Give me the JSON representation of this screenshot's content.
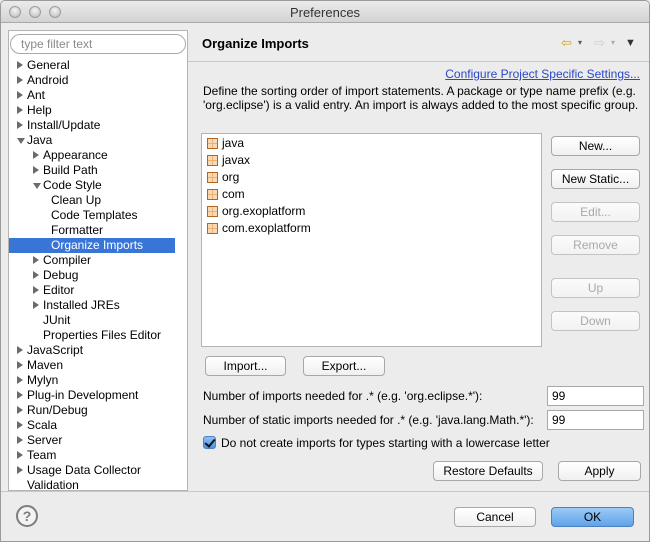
{
  "window": {
    "title": "Preferences"
  },
  "sidebar": {
    "filter_placeholder": "type filter text",
    "tree": [
      {
        "label": "General",
        "depth": 0,
        "state": "collapsed"
      },
      {
        "label": "Android",
        "depth": 0,
        "state": "collapsed"
      },
      {
        "label": "Ant",
        "depth": 0,
        "state": "collapsed"
      },
      {
        "label": "Help",
        "depth": 0,
        "state": "collapsed"
      },
      {
        "label": "Install/Update",
        "depth": 0,
        "state": "collapsed"
      },
      {
        "label": "Java",
        "depth": 0,
        "state": "expanded"
      },
      {
        "label": "Appearance",
        "depth": 1,
        "state": "collapsed"
      },
      {
        "label": "Build Path",
        "depth": 1,
        "state": "collapsed"
      },
      {
        "label": "Code Style",
        "depth": 1,
        "state": "expanded"
      },
      {
        "label": "Clean Up",
        "depth": 2,
        "state": "leaf"
      },
      {
        "label": "Code Templates",
        "depth": 2,
        "state": "leaf"
      },
      {
        "label": "Formatter",
        "depth": 2,
        "state": "leaf"
      },
      {
        "label": "Organize Imports",
        "depth": 2,
        "state": "leaf",
        "selected": true
      },
      {
        "label": "Compiler",
        "depth": 1,
        "state": "collapsed"
      },
      {
        "label": "Debug",
        "depth": 1,
        "state": "collapsed"
      },
      {
        "label": "Editor",
        "depth": 1,
        "state": "collapsed"
      },
      {
        "label": "Installed JREs",
        "depth": 1,
        "state": "collapsed"
      },
      {
        "label": "JUnit",
        "depth": 1,
        "state": "leaf"
      },
      {
        "label": "Properties Files Editor",
        "depth": 1,
        "state": "leaf"
      },
      {
        "label": "JavaScript",
        "depth": 0,
        "state": "collapsed"
      },
      {
        "label": "Maven",
        "depth": 0,
        "state": "collapsed"
      },
      {
        "label": "Mylyn",
        "depth": 0,
        "state": "collapsed"
      },
      {
        "label": "Plug-in Development",
        "depth": 0,
        "state": "collapsed"
      },
      {
        "label": "Run/Debug",
        "depth": 0,
        "state": "collapsed"
      },
      {
        "label": "Scala",
        "depth": 0,
        "state": "collapsed"
      },
      {
        "label": "Server",
        "depth": 0,
        "state": "collapsed"
      },
      {
        "label": "Team",
        "depth": 0,
        "state": "collapsed"
      },
      {
        "label": "Usage Data Collector",
        "depth": 0,
        "state": "collapsed"
      },
      {
        "label": "Validation",
        "depth": 0,
        "state": "leaf"
      }
    ]
  },
  "page": {
    "title": "Organize Imports",
    "configure_link": "Configure Project Specific Settings...",
    "description": "Define the sorting order of import statements. A package or type name prefix (e.g. 'org.eclipse') is a valid entry. An import is always added to the most specific group.",
    "import_order": [
      "java",
      "javax",
      "org",
      "com",
      "org.exoplatform",
      "com.exoplatform"
    ],
    "side_buttons": [
      {
        "label": "New...",
        "enabled": true
      },
      {
        "label": "New Static...",
        "enabled": true
      },
      {
        "label": "Edit...",
        "enabled": false
      },
      {
        "label": "Remove",
        "enabled": false
      },
      {
        "label": "Up",
        "enabled": false
      },
      {
        "label": "Down",
        "enabled": false
      }
    ],
    "import_button": "Import...",
    "export_button": "Export...",
    "imports_threshold_label": "Number of imports needed for .* (e.g. 'org.eclipse.*'):",
    "imports_threshold_value": "99",
    "static_threshold_label": "Number of static imports needed for .* (e.g. 'java.lang.Math.*'):",
    "static_threshold_value": "99",
    "lowercase_checkbox_label": "Do not create imports for types starting with a lowercase letter",
    "lowercase_checkbox_checked": true,
    "restore_defaults_button": "Restore Defaults",
    "apply_button": "Apply"
  },
  "footer": {
    "help_glyph": "?",
    "cancel_button": "Cancel",
    "ok_button": "OK"
  }
}
